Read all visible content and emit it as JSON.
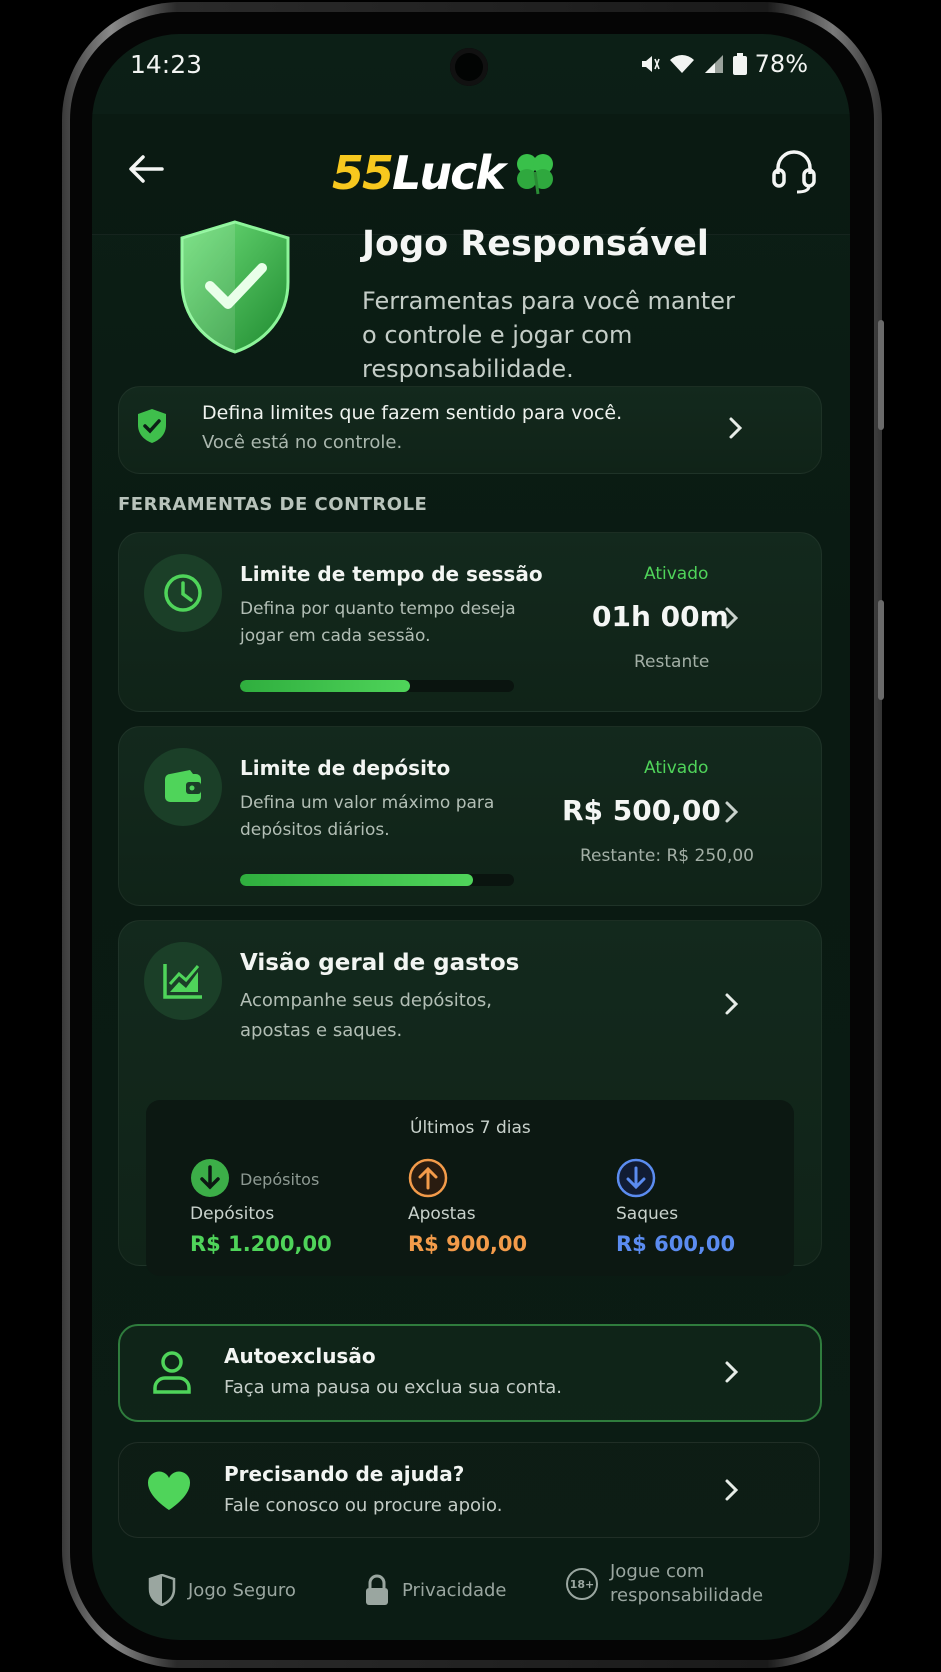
{
  "status_bar": {
    "time": "14:23",
    "battery": "78%"
  },
  "app_bar": {
    "logo_part1": "55",
    "logo_part2": "Luck"
  },
  "hero": {
    "title": "Jogo Responsável",
    "subtitle_line1": "Ferramentas para você manter",
    "subtitle_line2": "o controle e jogar com",
    "subtitle_line3": "responsabilidade."
  },
  "banner": {
    "title": "Defina limites que fazem sentido para você.",
    "subtitle": "Você está no controle."
  },
  "section_label": "FERRAMENTAS DE CONTROLE",
  "session_limit": {
    "title": "Limite de tempo de sessão",
    "desc_line1": "Defina por quanto tempo deseja",
    "desc_line2": "jogar em cada sessão.",
    "status": "Ativado",
    "value": "01h 00m",
    "remaining": "Restante",
    "progress": 0.62
  },
  "deposit_limit": {
    "title": "Limite de depósito",
    "desc_line1": "Defina um valor máximo para",
    "desc_line2": "depósitos diários.",
    "status": "Ativado",
    "value": "R$ 500,00",
    "remaining": "Restante: R$ 250,00",
    "progress": 0.85
  },
  "spending": {
    "title": "Visão geral de gastos",
    "desc_line1": "Acompanhe seus depósitos,",
    "desc_line2": "apostas e saques.",
    "period": "Últimos 7 dias",
    "icon_caption": "Depósitos",
    "stats": [
      {
        "label": "Depósitos",
        "value": "R$ 1.200,00",
        "color": "#4fd45a"
      },
      {
        "label": "Apostas",
        "value": "R$ 900,00",
        "color": "#f39b4a"
      },
      {
        "label": "Saques",
        "value": "R$ 600,00",
        "color": "#5b8cf0"
      }
    ]
  },
  "self_exclusion": {
    "title": "Autoexclusão",
    "subtitle": "Faça uma pausa ou exclua sua conta."
  },
  "help": {
    "title": "Precisando de ajuda?",
    "subtitle": "Fale conosco ou procure apoio."
  },
  "footer": {
    "safe": "Jogo Seguro",
    "privacy": "Privacidade",
    "age_badge": "18+",
    "responsible_line1": "Jogue com",
    "responsible_line2": "responsabilidade"
  },
  "colors": {
    "accent": "#4fd45a",
    "logo_yellow": "#f7c81e",
    "bets": "#f39b4a",
    "withdrawals": "#5b8cf0"
  }
}
